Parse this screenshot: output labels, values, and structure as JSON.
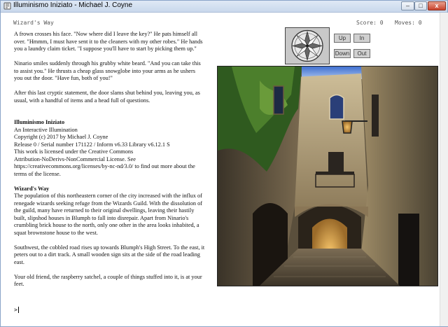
{
  "window": {
    "title": "Illuminismo Iniziato - Michael J. Coyne",
    "min_label": "–",
    "max_label": "□",
    "close_label": "x"
  },
  "status": {
    "location": "Wizard's Way",
    "score": "Score: 0",
    "moves": "Moves: 0"
  },
  "nav": {
    "up": "Up",
    "in": "In",
    "down": "Down",
    "out": "Out"
  },
  "story": {
    "p1": [
      "A frown crosses his face. \"Now where did I leave the key?\" He pats himself all",
      "over. \"Hmmm, I must have sent it to the cleaners with my other robes.\" He hands",
      "you a laundry claim ticket. \"I suppose you'll have to start by picking them up.\""
    ],
    "p2": [
      "Ninario smiles suddenly through his grubby white beard. \"And you can take this",
      "to assist you.\" He thrusts a cheap glass snowglobe into your arms as he ushers",
      "you out the door. \"Have fun, both of you!\""
    ],
    "p3": [
      "After this last cryptic statement, the door slams shut behind you, leaving you, as",
      "usual, with a handful of items and a head full of questions."
    ],
    "banner_title": "Illuminismo Iniziato",
    "banner_lines": [
      "An Interactive Illumination",
      "Copyright (c) 2017 by Michael J. Coyne",
      "Release 0 / Serial number 171122 / Inform v6.33 Library v6.12.1 S",
      "This work is licensed under the Creative Commons",
      "Attribution-NoDerivs-NonCommercial License. See",
      "https://creativecommons.org/licenses/by-nc-nd/3.0/ to find out more about the",
      "terms of the license."
    ],
    "room_title": "Wizard's Way",
    "room_lines": [
      "The population of this northeastern corner of the city increased with the influx of",
      "renegade wizards seeking refuge from the Wizards Guild. With the dissolution of",
      "the guild, many have returned to their original dwellings, leaving their hastily",
      "built, slipshod houses in Blumph to fall into disrepair. Apart from Ninario's",
      "crumbling brick house to the north, only one other in the area looks inhabited, a",
      "squat brownstone house to the west."
    ],
    "p4": [
      "Southwest, the cobbled road rises up towards Blumph's High Street. To the east, it",
      "peters out to a dirt track. A small wooden sign sits at the side of the road leading",
      "east."
    ],
    "p5": [
      "Your old friend, the raspberry satchel, a couple of things stuffed into it, is at your",
      "feet."
    ]
  },
  "prompt": ">"
}
